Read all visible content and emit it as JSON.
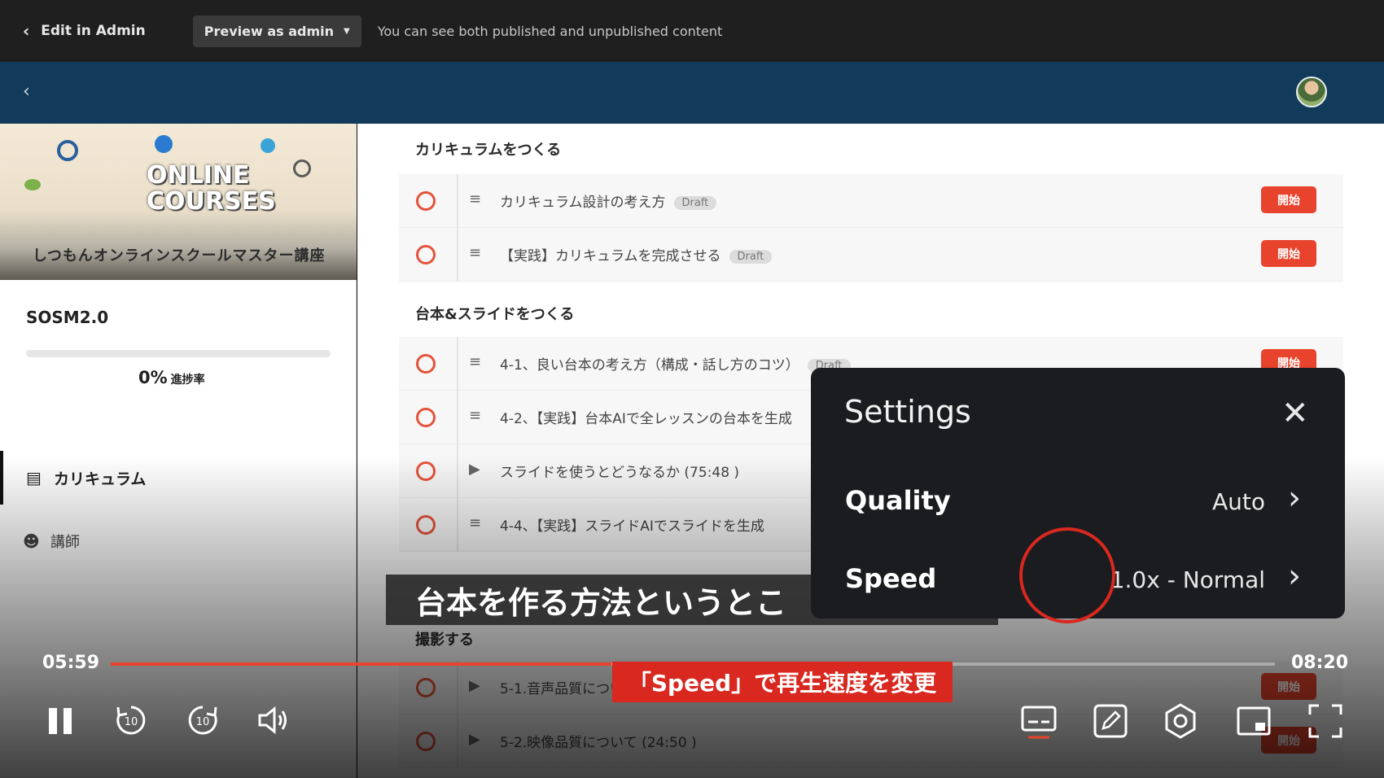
{
  "adminbar": {
    "back_label": "Edit in Admin",
    "preview_label": "Preview as admin",
    "note": "You can see both published and unpublished content"
  },
  "sidebar": {
    "banner_title_line1": "ONLINE",
    "banner_title_line2": "COURSES",
    "banner_subtitle": "しつもんオンラインスクールマスター講座",
    "course_title": "SOSM2.0",
    "progress_value": "0%",
    "progress_label": "進捗率",
    "progress_fraction": 0,
    "nav": [
      {
        "label": "カリキュラム",
        "icon": "list-icon"
      },
      {
        "label": "講師",
        "icon": "person-icon"
      }
    ]
  },
  "content": {
    "sections": [
      {
        "title": "カリキュラムをつくる",
        "lessons": [
          {
            "title": "カリキュラム設計の考え方",
            "badge": "Draft",
            "type": "text",
            "action": "開始"
          },
          {
            "title": "【実践】カリキュラムを完成させる",
            "badge": "Draft",
            "type": "text",
            "action": "開始"
          }
        ]
      },
      {
        "title": "台本&スライドをつくる",
        "lessons": [
          {
            "title": "4-1、良い台本の考え方（構成・話し方のコツ）",
            "badge": "Draft",
            "type": "text",
            "action": "開始"
          },
          {
            "title": "4-2、【実践】台本AIで全レッスンの台本を生成",
            "badge": "",
            "type": "text",
            "action": ""
          },
          {
            "title": "スライドを使うとどうなるか (75:48 )",
            "badge": "",
            "type": "video",
            "action": ""
          },
          {
            "title": "4-4、【実践】スライドAIでスライドを生成",
            "badge": "",
            "type": "text",
            "action": ""
          }
        ]
      },
      {
        "title": "撮影する",
        "lessons": [
          {
            "title": "5-1.音声品質について",
            "badge": "",
            "type": "video",
            "action": "開始"
          },
          {
            "title": "5-2.映像品質について (24:50 )",
            "badge": "",
            "type": "video",
            "action": "開始"
          }
        ]
      }
    ]
  },
  "player": {
    "current_time": "05:59",
    "duration": "08:20",
    "progress_fraction": 0.43,
    "subtitle": "台本を作る方法というとこ",
    "annotation": "「Speed」で再生速度を変更",
    "skip_seconds": "10",
    "settings": {
      "title": "Settings",
      "rows": [
        {
          "label": "Quality",
          "value": "Auto"
        },
        {
          "label": "Speed",
          "value": "1.0x - Normal"
        }
      ]
    },
    "accent_color": "#e8432c"
  }
}
